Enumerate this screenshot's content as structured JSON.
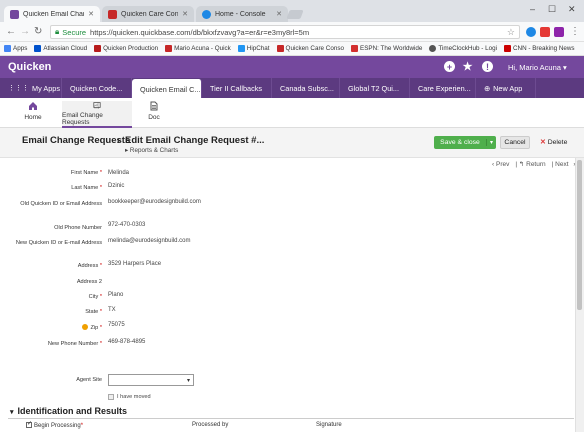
{
  "browser": {
    "tabs": [
      {
        "label": "Quicken Email Change R",
        "icon_color": "#74489d",
        "active": true
      },
      {
        "label": "Quicken Care Console",
        "icon_color": "#c62828",
        "active": false
      },
      {
        "label": "Home - Console",
        "icon_color": "#1e88e5",
        "active": false
      }
    ],
    "address": {
      "secure_label": "Secure",
      "url": "https://quicken.quickbase.com/db/bkxfzvavg?a=er&r=e3my8rl=5m"
    },
    "bookmarks": [
      {
        "label": "Apps",
        "icon_color": "#4285f4"
      },
      {
        "label": "Atlassian Cloud",
        "icon_color": "#0052cc"
      },
      {
        "label": "Quicken Production",
        "icon_color": "#b71c1c"
      },
      {
        "label": "Mario Acuna - Quick",
        "icon_color": "#c62828"
      },
      {
        "label": "HipChat",
        "icon_color": "#2196f3"
      },
      {
        "label": "Quicken Care Conso",
        "icon_color": "#c62828"
      },
      {
        "label": "ESPN: The Worldwide",
        "icon_color": "#d32f2f"
      },
      {
        "label": "TimeClockHub - Logi",
        "icon_color": "#555555"
      },
      {
        "label": "CNN - Breaking News",
        "icon_color": "#cc0000"
      }
    ]
  },
  "header": {
    "brand": "Quicken",
    "user_label": "Hi, Mario Acuna"
  },
  "app_tabs": [
    {
      "label": "My Apps"
    },
    {
      "label": "Quicken Code..."
    },
    {
      "label": "Quicken Email C..."
    },
    {
      "label": "Tier II Callbacks"
    },
    {
      "label": "Canada Subsc..."
    },
    {
      "label": "Global T2 Qui..."
    },
    {
      "label": "Care Experien..."
    },
    {
      "label": "New App"
    }
  ],
  "page_buttons": [
    {
      "label": "Home"
    },
    {
      "label": "Email Change Requests"
    },
    {
      "label": "Doc"
    }
  ],
  "titlebar": {
    "table_name": "Email Change Requests",
    "separator": "›",
    "record_title": "Edit Email Change Request #...",
    "reports_link": "Reports & Charts",
    "save_label": "Save & close",
    "cancel_label": "Cancel",
    "delete_label": "Delete"
  },
  "pager": {
    "prev": "Prev",
    "return": "Return",
    "next": "Next"
  },
  "form": {
    "fields": [
      {
        "label": "First Name",
        "required": true,
        "value": "Melinda"
      },
      {
        "label": "Last Name",
        "required": true,
        "value": "Dzinic"
      },
      {
        "label": "Old Quicken ID or Email Address",
        "required": false,
        "value": "bookkeeper@eurodesignbuild.com"
      },
      {
        "label": "Old Phone Number",
        "required": false,
        "value": "972-470-0303"
      },
      {
        "label": "New Quicken ID or E-mail Address",
        "required": false,
        "value": "melinda@eurodesignbuild.com"
      },
      {
        "label": "Address",
        "required": true,
        "value": "3529 Harpers Place"
      },
      {
        "label": "Address 2",
        "required": false,
        "value": ""
      },
      {
        "label": "City",
        "required": true,
        "value": "Plano"
      },
      {
        "label": "State",
        "required": true,
        "value": "TX"
      },
      {
        "label": "Zip",
        "required": true,
        "value": "75075"
      },
      {
        "label": "New Phone Number",
        "required": true,
        "value": "469-878-4895"
      }
    ],
    "agent_site_label": "Agent Site",
    "agent_site_value": "",
    "moved_label": "I have moved"
  },
  "section": {
    "title": "Identification and Results",
    "begin_processing": "Begin Processing",
    "processed_by": "Processed by",
    "signature": "Signature"
  }
}
